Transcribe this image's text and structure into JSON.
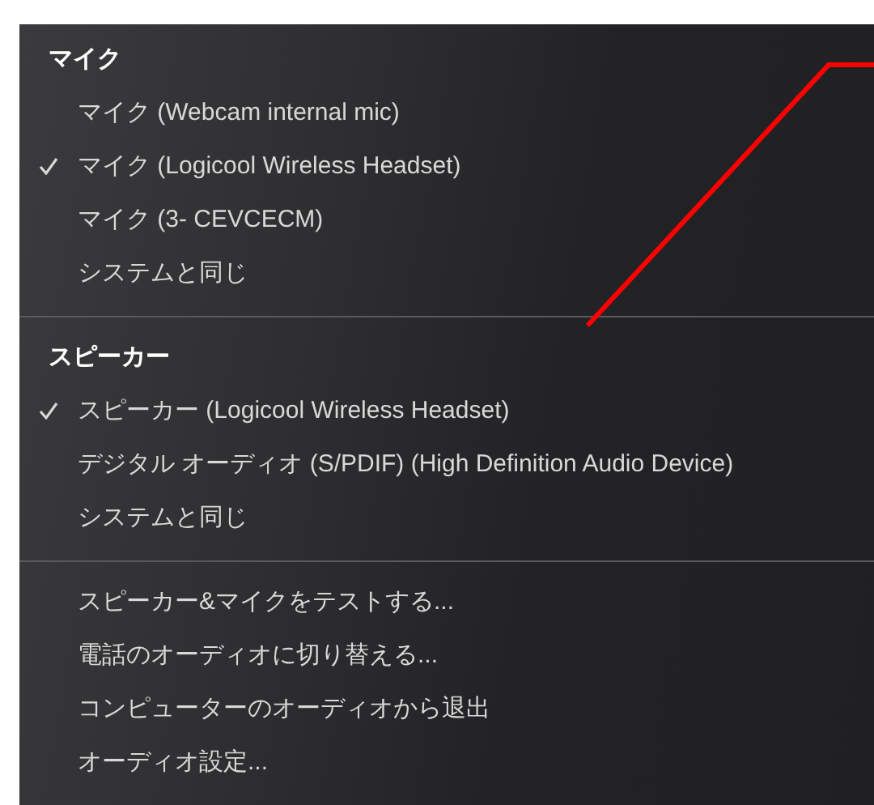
{
  "menu": {
    "sections": [
      {
        "kind": "devices",
        "header": "マイク",
        "items": [
          {
            "label": "マイク (Webcam internal mic)",
            "checked": false
          },
          {
            "label": "マイク (Logicool Wireless Headset)",
            "checked": true
          },
          {
            "label": "マイク (3- CEVCECM)",
            "checked": false
          },
          {
            "label": "システムと同じ",
            "checked": false
          }
        ]
      },
      {
        "kind": "devices",
        "header": "スピーカー",
        "items": [
          {
            "label": "スピーカー (Logicool Wireless Headset)",
            "checked": true
          },
          {
            "label": "デジタル オーディオ (S/PDIF) (High Definition Audio Device)",
            "checked": false
          },
          {
            "label": "システムと同じ",
            "checked": false
          }
        ]
      },
      {
        "kind": "actions",
        "items": [
          {
            "label": "スピーカー&マイクをテストする..."
          },
          {
            "label": "電話のオーディオに切り替える..."
          },
          {
            "label": "コンピューターのオーディオから退出"
          },
          {
            "label": "オーディオ設定..."
          }
        ]
      }
    ]
  }
}
